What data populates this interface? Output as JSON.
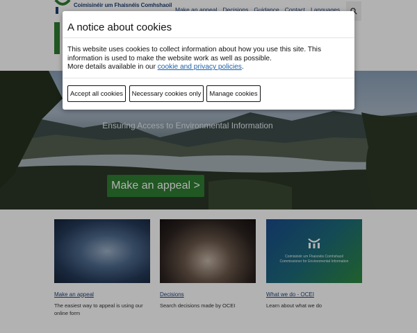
{
  "header": {
    "logo_text": "Coimisinéir um Fhaisnéis Comhshaoil",
    "nav": [
      "Make an appeal",
      "Decisions",
      "Guidance",
      "Contact",
      "Languages"
    ],
    "search_icon": "search-icon"
  },
  "hero": {
    "tagline": "Ensuring Access to Environmental Information",
    "cta_label": "Make an appeal >"
  },
  "cards": [
    {
      "title": "Make an appeal",
      "description": "The easiest way to appeal is using our online form"
    },
    {
      "title": "Decisions",
      "description": "Search decisions made by OCEI"
    },
    {
      "title": "What we do - OCEI",
      "description": "Learn about what we do",
      "image_text_line1": "Coimisinéir um Fhaisnéis Comhshaoil",
      "image_text_line2": "Commissioner for Environmental Information"
    }
  ],
  "cookie_modal": {
    "title": "A notice about cookies",
    "body_line1": "This website uses cookies to collect information about how you use this site. This",
    "body_line2": "information is used to make the website work as well as possible.",
    "body_line3_prefix": "More details available in our ",
    "link_text": "cookie and privacy policies",
    "body_line3_suffix": ".",
    "buttons": {
      "accept_all": "Accept all cookies",
      "necessary_only": "Necessary cookies only",
      "manage": "Manage cookies"
    }
  },
  "colors": {
    "brand_green": "#2e7d32",
    "brand_navy": "#1f3f73",
    "link_blue": "#1a5fa8"
  }
}
